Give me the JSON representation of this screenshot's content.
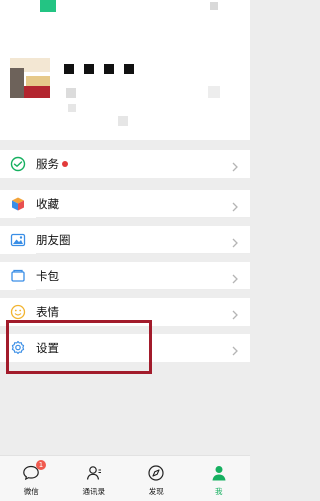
{
  "menu": {
    "items": [
      {
        "label": "服务",
        "icon": "wallet-icon",
        "has_dot": true
      },
      {
        "label": "收藏",
        "icon": "cube-icon"
      },
      {
        "label": "朋友圈",
        "icon": "image-icon"
      },
      {
        "label": "卡包",
        "icon": "card-icon"
      },
      {
        "label": "表情",
        "icon": "smile-icon"
      },
      {
        "label": "设置",
        "icon": "gear-icon"
      }
    ]
  },
  "tabs": [
    {
      "label": "微信",
      "badge": "1",
      "icon": "chat-icon"
    },
    {
      "label": "通讯录",
      "icon": "contacts-icon"
    },
    {
      "label": "发现",
      "icon": "compass-icon"
    },
    {
      "label": "我",
      "icon": "person-icon",
      "active": true
    }
  ],
  "colors": {
    "accent": "#16b060",
    "badge": "#f05a4f",
    "highlight_border": "#a21b2b",
    "background": "#ededed"
  }
}
